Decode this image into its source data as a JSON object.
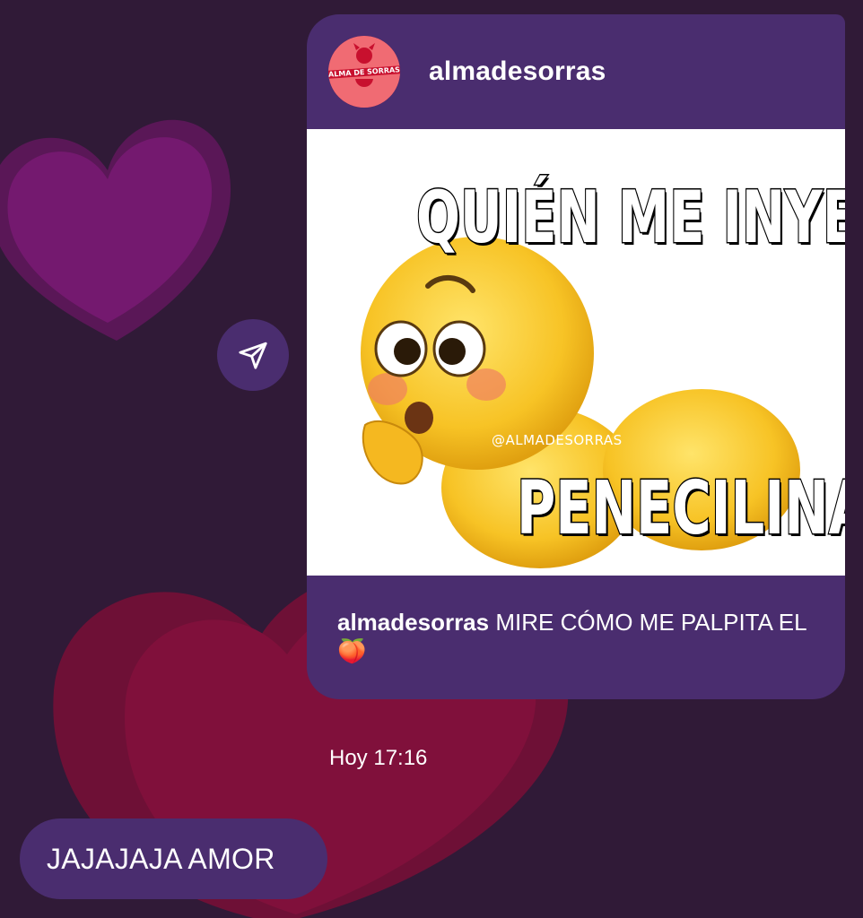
{
  "post": {
    "username": "almadesorras",
    "avatar_text": "ALMA DE SORRAS",
    "meme": {
      "top_text": "QUIÉN ME INYECTA",
      "bottom_text": "PENECILINA?",
      "watermark": "@ALMADESORRAS",
      "emoji": "flushed-face-emoji"
    },
    "caption_user": "almadesorras",
    "caption_text": "MIRE CÓMO ME PALPITA EL",
    "caption_emoji": "🍑"
  },
  "share_icon": "send-icon",
  "timestamp": "Hoy 17:16",
  "reply": {
    "text": "JAJAJAJA AMOR"
  },
  "colors": {
    "background": "#301a37",
    "bubble": "#4a2d6f",
    "heart_purple": "#6c1a6c",
    "heart_red": "#7d1038"
  }
}
